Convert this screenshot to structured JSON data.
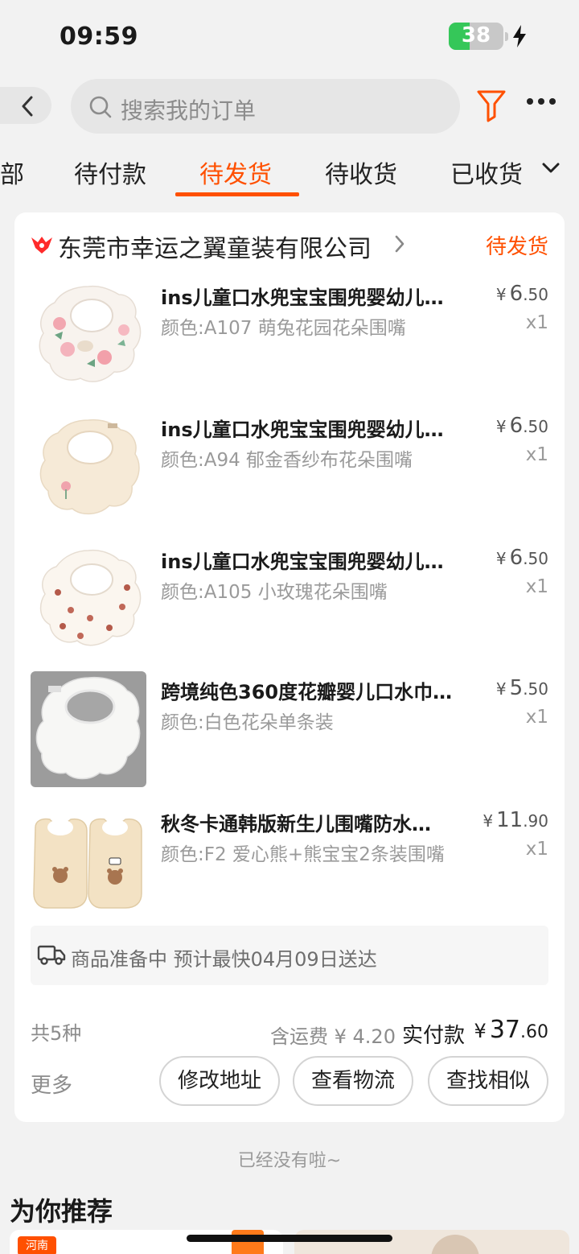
{
  "status_bar": {
    "time": "09:59",
    "battery": "38",
    "battery_level": 0.38
  },
  "search": {
    "placeholder": "搜索我的订单"
  },
  "tabs": [
    {
      "label": "部"
    },
    {
      "label": "待付款"
    },
    {
      "label": "待发货",
      "active": true
    },
    {
      "label": "待收货"
    },
    {
      "label": "已收货"
    }
  ],
  "order": {
    "shop_name": "东莞市幸运之翼童装有限公司",
    "status": "待发货",
    "items": [
      {
        "title": "ins儿童口水兜宝宝围兜婴幼儿…",
        "spec": "颜色:A107 萌兔花园花朵围嘴",
        "currency": "¥",
        "price_int": "6",
        "price_dec": ".50",
        "qty": "x1",
        "thumb": "bib-floral-green-icon"
      },
      {
        "title": "ins儿童口水兜宝宝围兜婴幼儿…",
        "spec": "颜色:A94 郁金香纱布花朵围嘴",
        "currency": "¥",
        "price_int": "6",
        "price_dec": ".50",
        "qty": "x1",
        "thumb": "bib-tulip-cream-icon"
      },
      {
        "title": "ins儿童口水兜宝宝围兜婴幼儿…",
        "spec": "颜色:A105 小玫瑰花朵围嘴",
        "currency": "¥",
        "price_int": "6",
        "price_dec": ".50",
        "qty": "x1",
        "thumb": "bib-rose-white-icon"
      },
      {
        "title": "跨境纯色360度花瓣婴儿口水巾…",
        "spec": "颜色:白色花朵单条装",
        "currency": "¥",
        "price_int": "5",
        "price_dec": ".50",
        "qty": "x1",
        "thumb": "bib-white-petal-icon"
      },
      {
        "title": "秋冬卡通韩版新生儿围嘴防水…",
        "spec": "颜色:F2 爱心熊+熊宝宝2条装围嘴",
        "currency": "¥",
        "price_int": "11",
        "price_dec": ".90",
        "qty": "x1",
        "thumb": "bib-bear-pair-icon"
      }
    ],
    "delivery_note": "商品准备中 预计最快04月09日送达",
    "summary": {
      "count": "共5种",
      "shipping": "含运费 ¥ 4.20",
      "paid_label": "实付款",
      "paid_currency": "¥",
      "paid_int": "37",
      "paid_dec": ".60"
    },
    "more": "更多",
    "actions": [
      "修改地址",
      "查看物流",
      "查找相似"
    ]
  },
  "end_hint": "已经没有啦~",
  "recommend": {
    "title": "为你推荐",
    "badge": "河南"
  },
  "colors": {
    "accent": "#ff5000",
    "battery_green": "#35c759",
    "page_bg": "#f2f2f2"
  }
}
